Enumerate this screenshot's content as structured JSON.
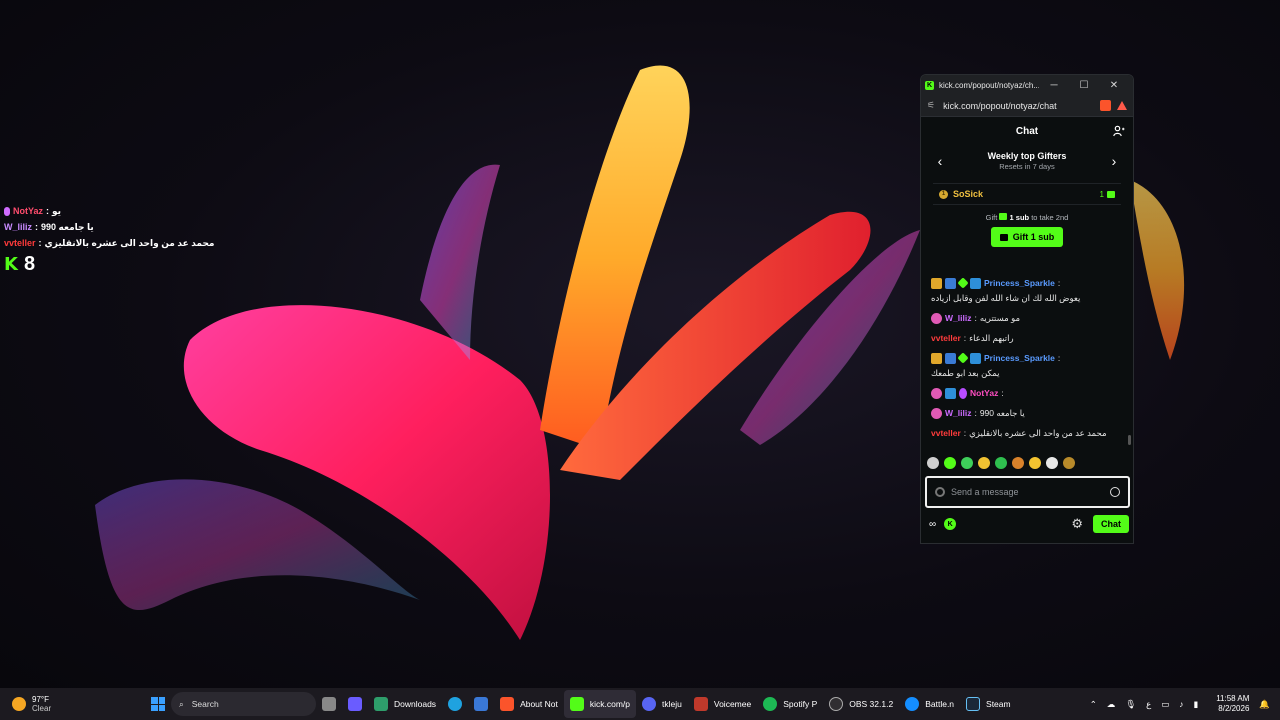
{
  "overlay": {
    "lines": [
      {
        "user": "NotYaz",
        "sep": ":",
        "msg": "يو"
      },
      {
        "user": "W_liliz",
        "sep": ":",
        "msg": "990 يا جامعه"
      },
      {
        "user": "vvteller",
        "sep": ":",
        "msg": "محمد عد من واحد الى عشره بالانقليزي"
      }
    ],
    "viewer_count": "8",
    "k_glyph": "K"
  },
  "window": {
    "title": "kick.com/popout/notyaz/ch...",
    "url": "kick.com/popout/notyaz/chat",
    "minimize": "─",
    "maximize": "☐",
    "close": "✕"
  },
  "chat": {
    "header": "Chat",
    "gifters_title": "Weekly top Gifters",
    "gifters_subtitle": "Resets in 7 days",
    "prev_arrow": "‹",
    "next_arrow": "›",
    "top_gifter": {
      "name": "SoSick",
      "count": "1",
      "rank": "1"
    },
    "gift_note_prefix": "Gift",
    "gift_note_bold": "1 sub",
    "gift_note_suffix": "to take 2nd",
    "gift_button": "Gift 1 sub",
    "messages": [
      {
        "user": "Princess_Sparkle",
        "sep": ":",
        "text": "يعوض الله لك ان شاء الله لفن وقابل ازياده"
      },
      {
        "user": "W_liliz",
        "sep": ":",
        "text": "مو مستتريه"
      },
      {
        "user": "vvteller",
        "sep": ":",
        "text": "راتبهم الدعاء"
      },
      {
        "user": "Princess_Sparkle",
        "sep": ":",
        "text": "يمكن بعد ابو طمعك"
      },
      {
        "user": "NotYaz",
        "sep": ":",
        "text": ""
      },
      {
        "user": "W_liliz",
        "sep": ":",
        "text": "990 يا جامعه"
      },
      {
        "user": "vvteller",
        "sep": ":",
        "text": "محمد عد من واحد الى عشره بالانقليزي"
      }
    ],
    "input_placeholder": "Send a message",
    "infinity": "∞",
    "send_button": "Chat",
    "gear": "⚙"
  },
  "taskbar": {
    "weather_temp": "97°F",
    "weather_cond": "Clear",
    "search_label": "Search",
    "items": [
      "Downloads",
      "About Not",
      "kick.com/p",
      "tkleju",
      "Voicemee",
      "Spotify P",
      "OBS 32.1.2",
      "Battle.n",
      "Steam"
    ],
    "time": "11:58 AM",
    "date": "8/2/2026",
    "lang": "ع"
  },
  "colors": {
    "kick_green": "#53fc18",
    "taskbar_bg": "#1c1a20"
  }
}
